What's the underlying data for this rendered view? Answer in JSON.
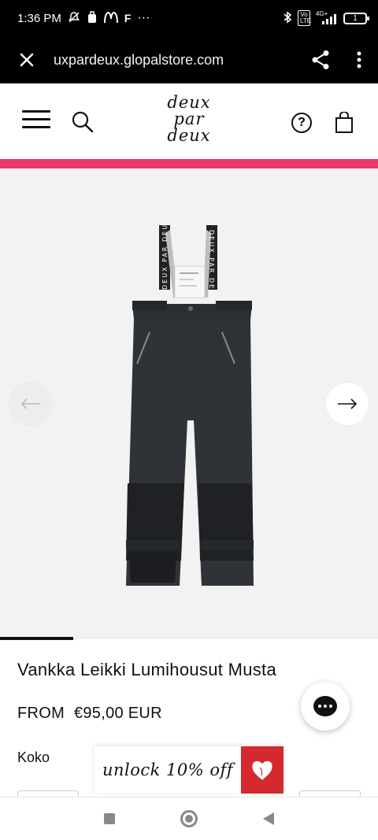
{
  "status_bar": {
    "time": "1:36 PM",
    "carrier_letter": "F",
    "more": "···",
    "network": "4G+",
    "volte": "Vo LTE",
    "battery": "1"
  },
  "browser": {
    "url": "uxpardeux.glopalstore.com"
  },
  "header": {
    "logo_line1": "deux",
    "logo_line2": "par",
    "logo_line3": "deux",
    "help_label": "?"
  },
  "product": {
    "title": "Vankka Leikki Lumihousut Musta",
    "price_from": "FROM",
    "price": "€95,00 EUR",
    "size_label": "Koko",
    "strap_text": "DEUX PAR DEUX"
  },
  "promo": {
    "unlock_text": "unlock 10% off"
  },
  "colors": {
    "accent_bar": "#e83b6c",
    "promo_heart_bg": "#d42a2f",
    "product_fabric": "#2b2e33"
  }
}
